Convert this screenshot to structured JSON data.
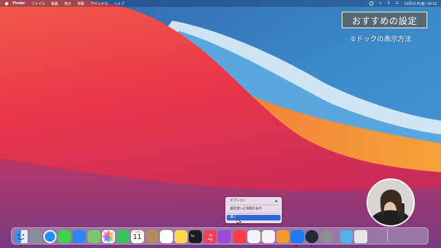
{
  "menubar": {
    "app_name": "Finder",
    "items": [
      "ファイル",
      "編集",
      "表示",
      "移動",
      "ウインドウ",
      "ヘルプ"
    ],
    "clock": "12月11日(金)  18:11"
  },
  "overlay": {
    "title": "おすすめの設定",
    "subtitle": "②ドックの表示方法"
  },
  "context_menu": {
    "items": [
      {
        "label": "オプション",
        "has_submenu": true,
        "selected": false
      },
      {
        "label": "最近使った項目を表示",
        "has_submenu": false,
        "selected": false
      },
      {
        "label": "開く",
        "has_submenu": false,
        "selected": true
      }
    ]
  },
  "dock": {
    "calendar": {
      "month": "12月",
      "day": "11"
    },
    "tv_label": "tv",
    "apps": [
      {
        "name": "finder-icon",
        "color": "#3b8ef0",
        "running": true
      },
      {
        "name": "launchpad-icon",
        "color": "#8a8f9c",
        "running": false
      },
      {
        "name": "safari-icon",
        "color": "#1e90ff",
        "running": false
      },
      {
        "name": "messages-icon",
        "color": "#3cd44f",
        "running": false
      },
      {
        "name": "mail-icon",
        "color": "#2a86f0",
        "running": false
      },
      {
        "name": "maps-icon",
        "color": "#7bc96f",
        "running": false
      },
      {
        "name": "photos-icon",
        "color": "#f2f2f2",
        "running": false
      },
      {
        "name": "facetime-icon",
        "color": "#34c759",
        "running": false
      },
      {
        "name": "calendar-icon",
        "color": "#ffffff",
        "running": false
      },
      {
        "name": "contacts-icon",
        "color": "#b58b5b",
        "running": false
      },
      {
        "name": "reminders-icon",
        "color": "#ffffff",
        "running": false
      },
      {
        "name": "notes-icon",
        "color": "#ffd54a",
        "running": false
      },
      {
        "name": "apple-tv-icon",
        "color": "#1c1c1e",
        "running": false
      },
      {
        "name": "music-icon",
        "color": "#fa3c57",
        "running": false
      },
      {
        "name": "podcasts-icon",
        "color": "#9b4bd8",
        "running": false
      },
      {
        "name": "news-icon",
        "color": "#ff3b45",
        "running": false
      },
      {
        "name": "keynote-icon",
        "color": "#f0f3f7",
        "running": false
      },
      {
        "name": "numbers-icon",
        "color": "#f5f5f5",
        "running": false
      },
      {
        "name": "pages-icon",
        "color": "#f39a2a",
        "running": false
      },
      {
        "name": "app-store-icon",
        "color": "#1a7cf5",
        "running": true
      },
      {
        "name": "screenshot-icon",
        "color": "#202a36",
        "running": true
      },
      {
        "name": "system-preferences-icon",
        "color": "#8e8e93",
        "running": false
      },
      {
        "name": "downloads-folder-icon",
        "color": "#4fb2ec",
        "running": false
      },
      {
        "name": "trash-icon",
        "color": "#e6e6ea",
        "running": false
      }
    ]
  }
}
